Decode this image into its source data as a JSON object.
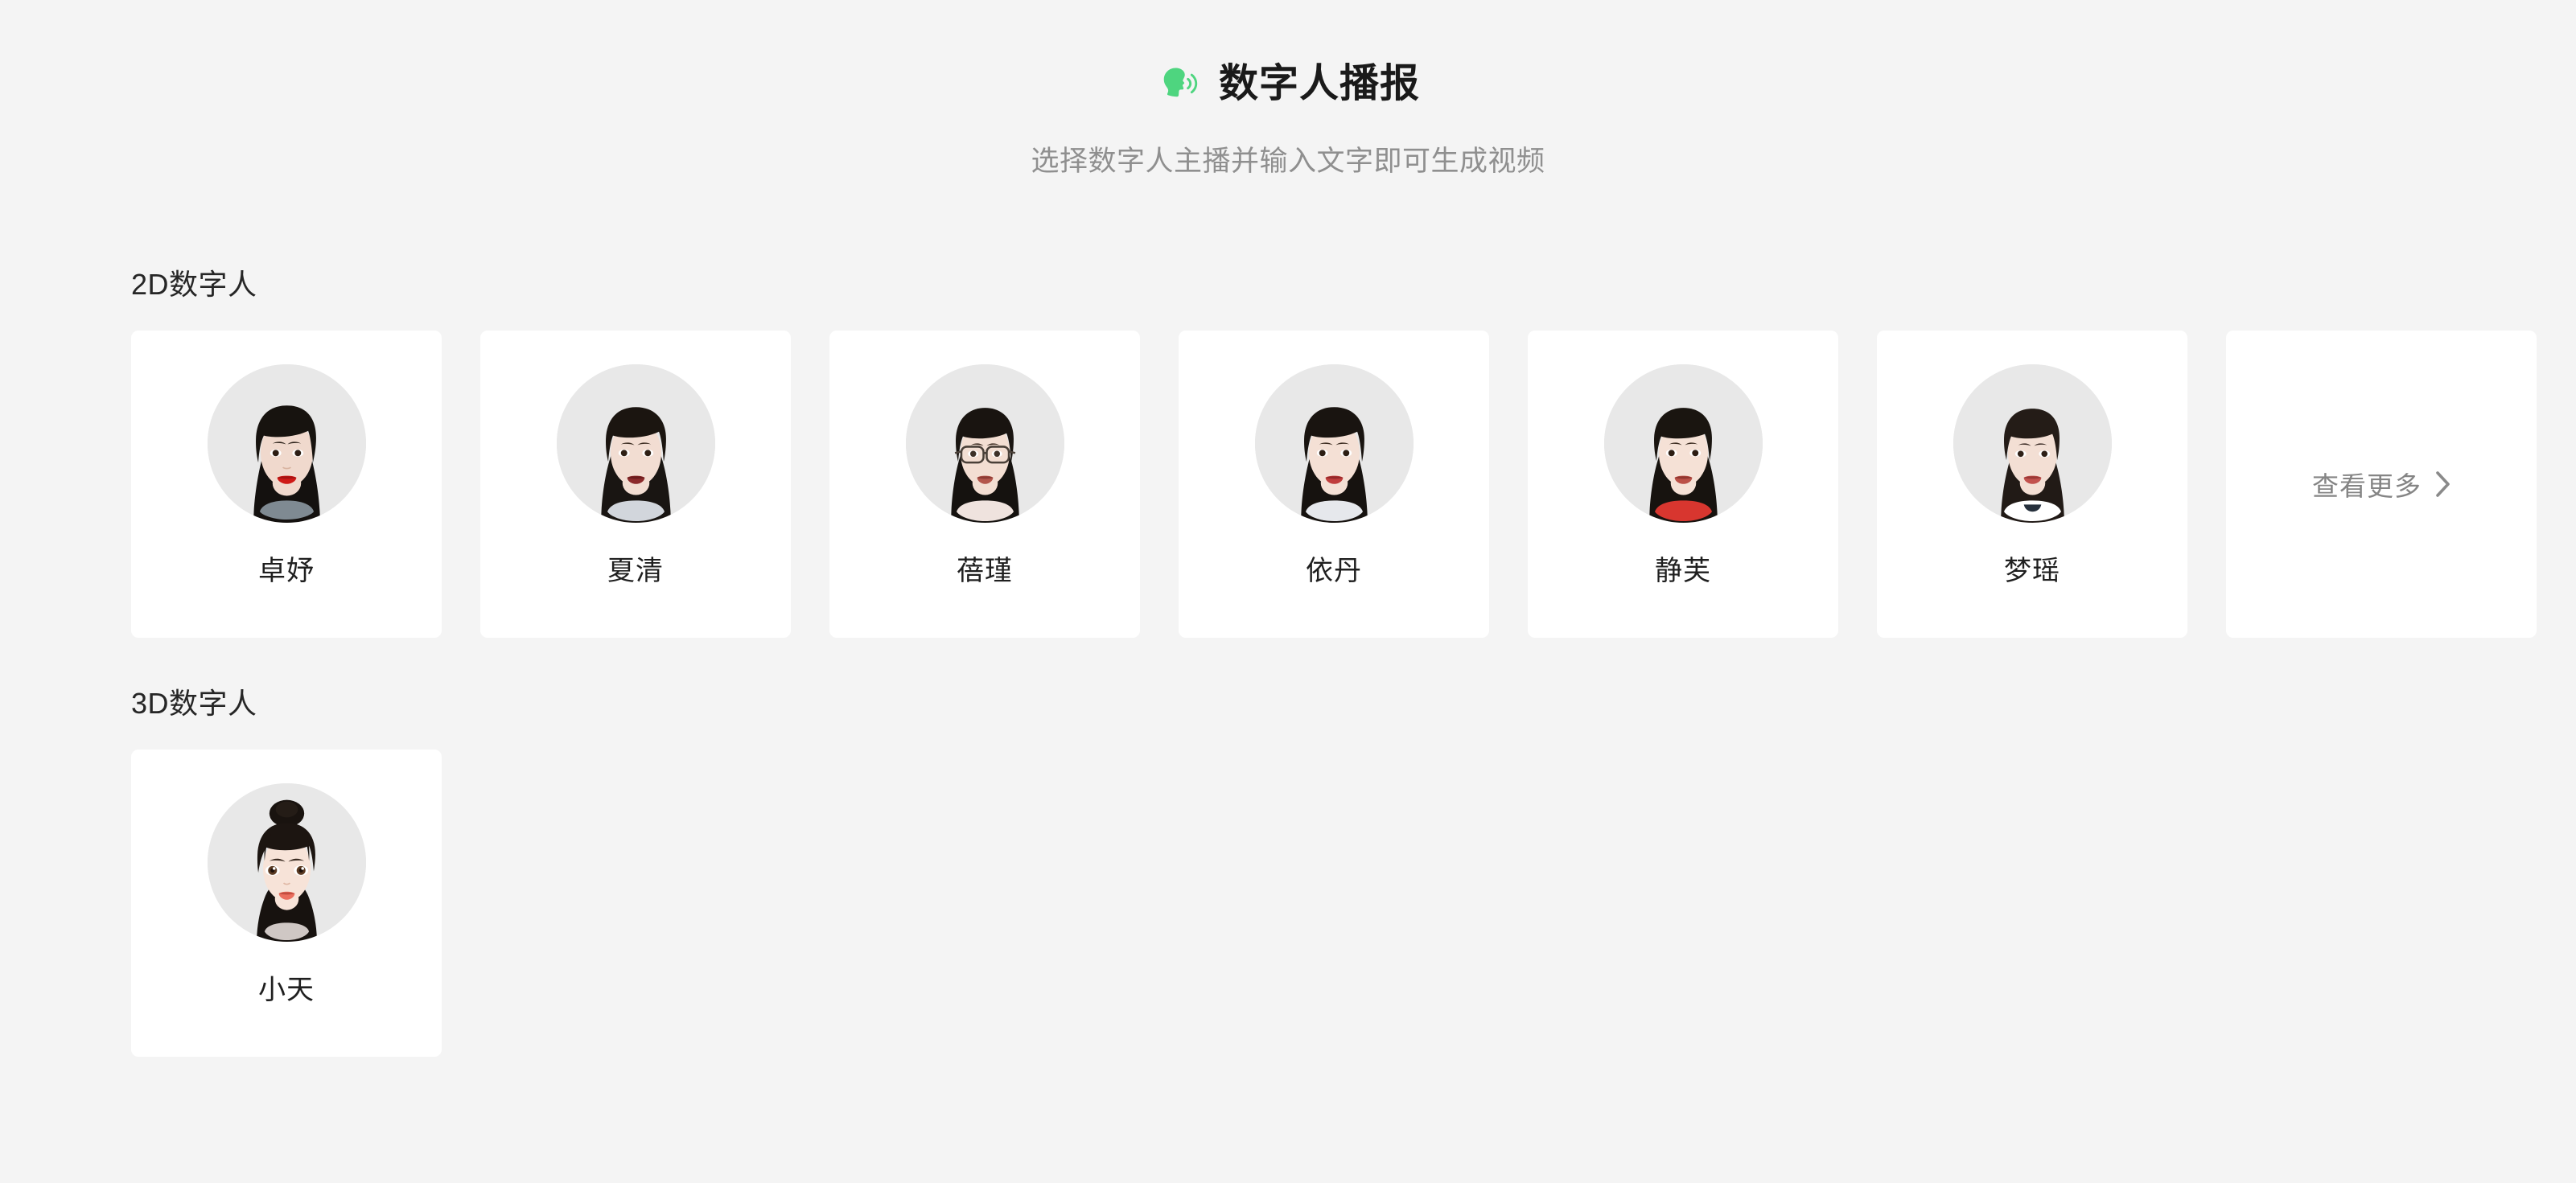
{
  "header": {
    "icon": "speaking-head-icon",
    "icon_color": "#4ed57f",
    "title": "数字人播报",
    "subtitle": "选择数字人主播并输入文字即可生成视频"
  },
  "theme": {
    "background": "#f4f4f4",
    "card_background": "#ffffff",
    "accent": "#4ed57f",
    "title_color": "#1a1a1a",
    "subtitle_color": "#8f8f8f",
    "muted_text": "#858585",
    "avatar_circle_background": "#e8e8e8"
  },
  "sections": [
    {
      "id": "2d",
      "heading": "2D数字人",
      "cards": [
        {
          "name": "卓妤",
          "avatar": "avatar-zhuoyu"
        },
        {
          "name": "夏清",
          "avatar": "avatar-xiaqing"
        },
        {
          "name": "蓓瑾",
          "avatar": "avatar-beijin"
        },
        {
          "name": "依丹",
          "avatar": "avatar-yidan"
        },
        {
          "name": "静芙",
          "avatar": "avatar-jingfu"
        },
        {
          "name": "梦瑶",
          "avatar": "avatar-mengyao"
        }
      ],
      "more": {
        "label": "查看更多",
        "icon": "chevron-right-icon"
      }
    },
    {
      "id": "3d",
      "heading": "3D数字人",
      "cards": [
        {
          "name": "小天",
          "avatar": "avatar-xiaotian"
        }
      ]
    }
  ]
}
